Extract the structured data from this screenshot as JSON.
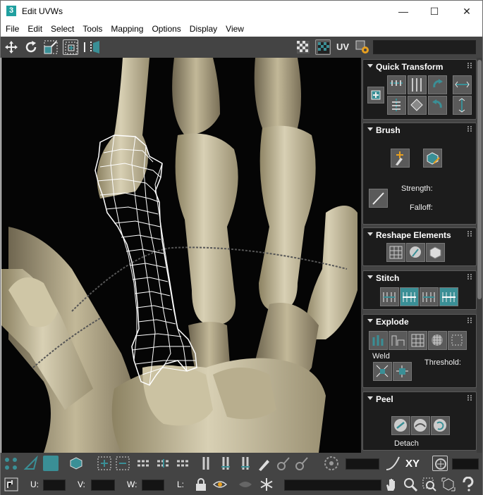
{
  "window": {
    "title": "Edit UVWs",
    "app_icon": "3",
    "controls": [
      "minimize-icon",
      "maximize-icon",
      "close-icon"
    ]
  },
  "menu": [
    "File",
    "Edit",
    "Select",
    "Tools",
    "Mapping",
    "Options",
    "Display",
    "View"
  ],
  "toolbar": {
    "uv_label": "UV",
    "icons": [
      "move-icon",
      "rotate-icon",
      "scale-icon",
      "freeform-icon",
      "mirror-icon",
      "checker-icon",
      "map-texture-icon",
      "settings-icon"
    ]
  },
  "panels": {
    "quick_transform": {
      "title": "Quick Transform"
    },
    "brush": {
      "title": "Brush",
      "strength_label": "Strength:",
      "falloff_label": "Falloff:"
    },
    "reshape": {
      "title": "Reshape Elements"
    },
    "stitch": {
      "title": "Stitch"
    },
    "explode": {
      "title": "Explode",
      "weld_label": "Weld",
      "threshold_label": "Threshold:"
    },
    "peel": {
      "title": "Peel",
      "detach_label": "Detach"
    }
  },
  "bottom": {
    "xy_label": "XY",
    "u_label": "U:",
    "v_label": "V:",
    "w_label": "W:",
    "l_label": "L:"
  },
  "colors": {
    "accent": "#3a8f96",
    "panel_bg": "#1c1c1c",
    "toolbar_bg": "#444444",
    "uv_wire": "#ffffff"
  }
}
